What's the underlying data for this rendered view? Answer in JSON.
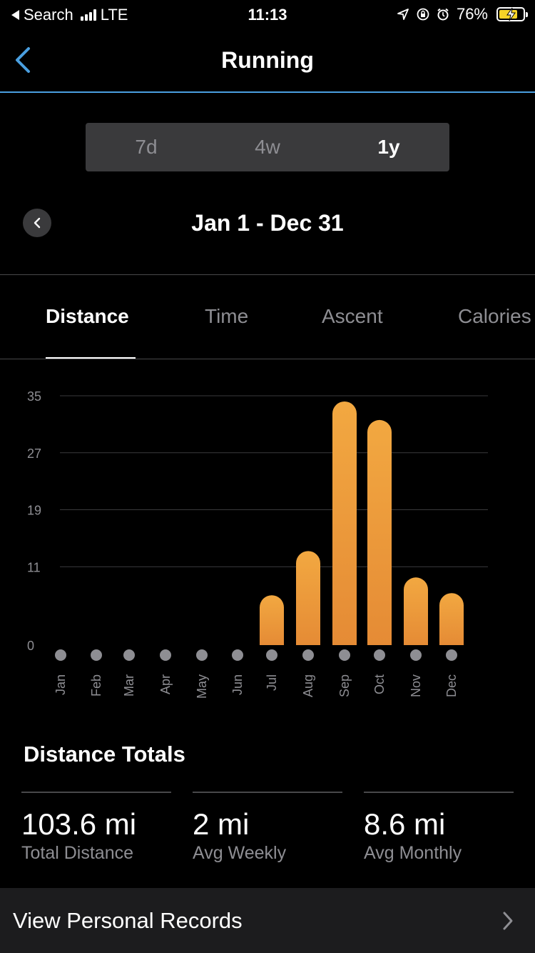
{
  "status_bar": {
    "back_app": "Search",
    "network": "LTE",
    "time": "11:13",
    "battery": "76%",
    "battery_level": 0.76
  },
  "nav": {
    "title": "Running"
  },
  "range_tabs": [
    {
      "label": "7d",
      "active": false
    },
    {
      "label": "4w",
      "active": false
    },
    {
      "label": "1y",
      "active": true
    }
  ],
  "date_range": "Jan 1 - Dec 31",
  "metric_tabs": [
    {
      "label": "Distance",
      "active": true
    },
    {
      "label": "Time",
      "active": false
    },
    {
      "label": "Ascent",
      "active": false
    },
    {
      "label": "Calories",
      "active": false
    }
  ],
  "chart_data": {
    "type": "bar",
    "categories": [
      "Jan",
      "Feb",
      "Mar",
      "Apr",
      "May",
      "Jun",
      "Jul",
      "Aug",
      "Sep",
      "Oct",
      "Nov",
      "Dec"
    ],
    "values": [
      0,
      0,
      0,
      0,
      0,
      0,
      7,
      13.2,
      34.2,
      31.6,
      9.5,
      7.3
    ],
    "yticks": [
      0,
      11,
      19,
      27,
      35
    ],
    "ylim": [
      0,
      35
    ],
    "grid": true,
    "bar_color": "#ef9e38"
  },
  "totals": {
    "title": "Distance Totals",
    "stats": [
      {
        "value": "103.6 mi",
        "label": "Total Distance"
      },
      {
        "value": "2 mi",
        "label": "Avg Weekly"
      },
      {
        "value": "8.6 mi",
        "label": "Avg Monthly"
      }
    ]
  },
  "records_link": "View Personal Records",
  "colors": {
    "accent": "#4a9fe0",
    "bar": "#ef9e38",
    "background": "#000000"
  }
}
